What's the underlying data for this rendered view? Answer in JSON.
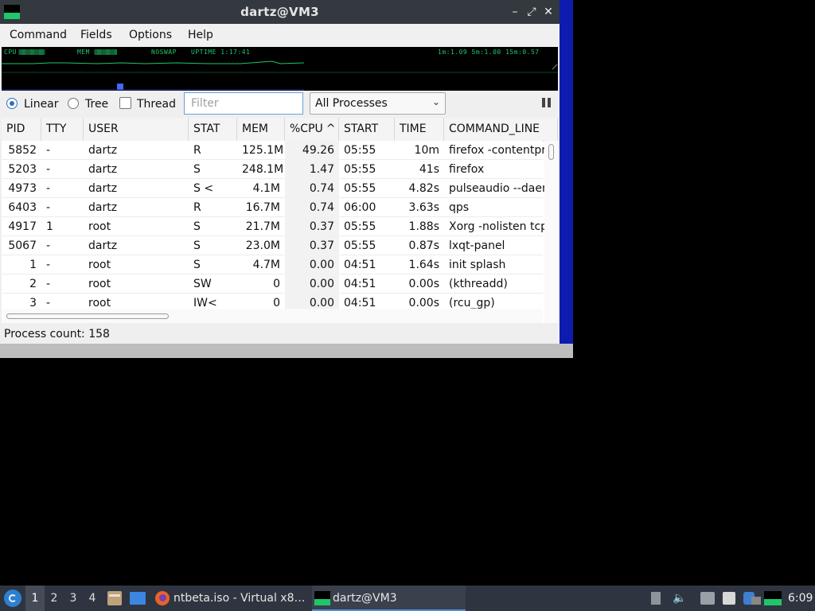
{
  "window": {
    "title": "dartz@VM3",
    "controls": {
      "minimize": "–",
      "maximize": "⤢",
      "close": "✕"
    }
  },
  "menu": [
    "Command",
    "Fields",
    "Options",
    "Help"
  ],
  "graph": {
    "cpu_label": "CPU",
    "mem_label": "MEM",
    "noswap_label": "NOSWAP",
    "uptime_label": "UPTIME 1:17:41",
    "load_label": "1m:1.09 5m:1.00 15m:0.57",
    "colors": {
      "cpu": "#1fc66a",
      "mem": "#1fc66a",
      "load": "#4466ff"
    }
  },
  "toolbar": {
    "linear_label": "Linear",
    "tree_label": "Tree",
    "thread_label": "Thread",
    "view_mode": "Linear",
    "thread_checked": false,
    "filter_placeholder": "Filter",
    "filter_value": "",
    "process_select": "All Processes"
  },
  "table": {
    "columns": [
      "PID",
      "TTY",
      "USER",
      "STAT",
      "MEM",
      "%CPU",
      "START",
      "TIME",
      "COMMAND_LINE"
    ],
    "sort_indicator": "^",
    "rows": [
      [
        "5852",
        "-",
        "dartz",
        "R",
        "125.1M",
        "49.26",
        "05:55",
        "10m",
        "firefox -contentproc"
      ],
      [
        "5203",
        "-",
        "dartz",
        "S",
        "248.1M",
        "1.47",
        "05:55",
        "41s",
        "firefox"
      ],
      [
        "4973",
        "-",
        "dartz",
        "S <",
        "4.1M",
        "0.74",
        "05:55",
        "4.82s",
        "pulseaudio --daemonize"
      ],
      [
        "6403",
        "-",
        "dartz",
        "R",
        "16.7M",
        "0.74",
        "06:00",
        "3.63s",
        "qps"
      ],
      [
        "4917",
        "1",
        "root",
        "S",
        "21.7M",
        "0.37",
        "05:55",
        "1.88s",
        "Xorg -nolisten tcp"
      ],
      [
        "5067",
        "-",
        "dartz",
        "S",
        "23.0M",
        "0.37",
        "05:55",
        "0.87s",
        "lxqt-panel"
      ],
      [
        "1",
        "-",
        "root",
        "S",
        "4.7M",
        "0.00",
        "04:51",
        "1.64s",
        "init splash"
      ],
      [
        "2",
        "-",
        "root",
        "SW",
        "0",
        "0.00",
        "04:51",
        "0.00s",
        "(kthreadd)"
      ],
      [
        "3",
        "-",
        "root",
        "IW<",
        "0",
        "0.00",
        "04:51",
        "0.00s",
        "(rcu_gp)"
      ]
    ]
  },
  "status": {
    "process_count": "Process count: 158"
  },
  "taskbar": {
    "workspaces": [
      "1",
      "2",
      "3",
      "4"
    ],
    "active_workspace": "1",
    "tasks": [
      {
        "label": "ntbeta.iso - Virtual x8…",
        "icon": "firefox-icon"
      },
      {
        "label": "dartz@VM3",
        "icon": "qps-icon",
        "active": true
      }
    ],
    "tray_icons": [
      "eject-icon",
      "volume-icon",
      "network-icon",
      "clipboard-icon",
      "notification-icon",
      "drive-icon",
      "qps-tray-icon"
    ],
    "clock": "6:09"
  }
}
